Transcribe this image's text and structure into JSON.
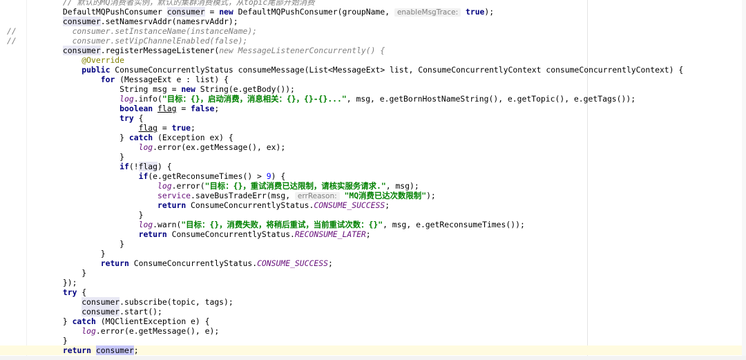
{
  "editor": {
    "lines": [
      [
        {
          "t": "        "
        },
        {
          "t": "// 默认的MQ消费者实例，默认的集群消费模式，从topic尾部开始消费",
          "c": "cm"
        }
      ],
      [
        {
          "t": "        DefaultMQPushConsumer "
        },
        {
          "t": "consumer",
          "c": "var"
        },
        {
          "t": " = "
        },
        {
          "t": "new",
          "c": "kw"
        },
        {
          "t": " DefaultMQPushConsumer(groupName, "
        },
        {
          "t": "enableMsgTrace:",
          "c": "hint"
        },
        {
          "t": " "
        },
        {
          "t": "true",
          "c": "kw"
        },
        {
          "t": ");"
        }
      ],
      [
        {
          "t": "        "
        },
        {
          "t": "consumer",
          "c": "var"
        },
        {
          "t": ".setNamesrvAddr(namesrvAddr);"
        }
      ],
      [
        {
          "t": "          "
        },
        {
          "t": "consumer",
          "c": "cm"
        },
        {
          "t": ".setInstanceName(instanceName);",
          "c": "cm"
        }
      ],
      [
        {
          "t": "          "
        },
        {
          "t": "consumer",
          "c": "cm"
        },
        {
          "t": ".setVipChannelEnabled(false);",
          "c": "cm"
        }
      ],
      [
        {
          "t": "        "
        },
        {
          "t": "consumer",
          "c": "var"
        },
        {
          "t": ".registerMessageListener("
        },
        {
          "t": "new MessageListenerConcurrently() {",
          "c": "cm"
        }
      ],
      [
        {
          "t": "            "
        },
        {
          "t": "@Override",
          "c": "ann"
        }
      ],
      [
        {
          "t": "            "
        },
        {
          "t": "public",
          "c": "kw"
        },
        {
          "t": " ConsumeConcurrentlyStatus consumeMessage(List<MessageExt> list, ConsumeConcurrentlyContext consumeConcurrentlyContext) {"
        }
      ],
      [
        {
          "t": "                "
        },
        {
          "t": "for",
          "c": "kw"
        },
        {
          "t": " (MessageExt e : list) {"
        }
      ],
      [
        {
          "t": "                    String msg = "
        },
        {
          "t": "new",
          "c": "kw"
        },
        {
          "t": " String(e.getBody());"
        }
      ],
      [
        {
          "t": "                    "
        },
        {
          "t": "log",
          "c": "logv"
        },
        {
          "t": ".info("
        },
        {
          "t": "\"目标：{}，启动消费，消息相关：{}，{}-{}...\"",
          "c": "str"
        },
        {
          "t": ", msg, e.getBornHostNameString(), e.getTopic(), e.getTags());"
        }
      ],
      [
        {
          "t": "                    "
        },
        {
          "t": "boolean",
          "c": "kw"
        },
        {
          "t": " "
        },
        {
          "t": "flag",
          "c": "uline"
        },
        {
          "t": " = "
        },
        {
          "t": "false",
          "c": "kw"
        },
        {
          "t": ";"
        }
      ],
      [
        {
          "t": "                    "
        },
        {
          "t": "try",
          "c": "kw"
        },
        {
          "t": " {"
        }
      ],
      [
        {
          "t": "                        "
        },
        {
          "t": "flag",
          "c": "uline"
        },
        {
          "t": " = "
        },
        {
          "t": "true",
          "c": "kw"
        },
        {
          "t": ";"
        }
      ],
      [
        {
          "t": "                    } "
        },
        {
          "t": "catch",
          "c": "kw"
        },
        {
          "t": " (Exception ex) {"
        }
      ],
      [
        {
          "t": "                        "
        },
        {
          "t": "log",
          "c": "logv"
        },
        {
          "t": ".error(ex.getMessage(), ex);"
        }
      ],
      [
        {
          "t": "                    }"
        }
      ],
      [
        {
          "t": "                    "
        },
        {
          "t": "if",
          "c": "kw"
        },
        {
          "t": "(!"
        },
        {
          "t": "flag",
          "c": "var"
        },
        {
          "t": ") {"
        }
      ],
      [
        {
          "t": "                        "
        },
        {
          "t": "if",
          "c": "kw"
        },
        {
          "t": "(e.getReconsumeTimes() > "
        },
        {
          "t": "9",
          "c": "num"
        },
        {
          "t": ") {"
        }
      ],
      [
        {
          "t": "                            "
        },
        {
          "t": "log",
          "c": "logv"
        },
        {
          "t": ".error("
        },
        {
          "t": "\"目标：{}，重试消费已达限制，请核实服务请求.\"",
          "c": "str"
        },
        {
          "t": ", msg);"
        }
      ],
      [
        {
          "t": "                            "
        },
        {
          "t": "service",
          "c": "fld"
        },
        {
          "t": ".saveBusTradeErr(msg, "
        },
        {
          "t": "errReason:",
          "c": "hint"
        },
        {
          "t": " "
        },
        {
          "t": "\"MQ消费已达次数限制\"",
          "c": "str"
        },
        {
          "t": ");"
        }
      ],
      [
        {
          "t": "                            "
        },
        {
          "t": "return",
          "c": "kw"
        },
        {
          "t": " ConsumeConcurrentlyStatus."
        },
        {
          "t": "CONSUME_SUCCESS",
          "c": "stat"
        },
        {
          "t": ";"
        }
      ],
      [
        {
          "t": "                        }"
        }
      ],
      [
        {
          "t": "                        "
        },
        {
          "t": "log",
          "c": "logv"
        },
        {
          "t": ".warn("
        },
        {
          "t": "\"目标：{}，消费失败，将稍后重试，当前重试次数：{}\"",
          "c": "str"
        },
        {
          "t": ", msg, e.getReconsumeTimes());"
        }
      ],
      [
        {
          "t": "                        "
        },
        {
          "t": "return",
          "c": "kw"
        },
        {
          "t": " ConsumeConcurrentlyStatus."
        },
        {
          "t": "RECONSUME_LATER",
          "c": "stat"
        },
        {
          "t": ";"
        }
      ],
      [
        {
          "t": "                    }"
        }
      ],
      [
        {
          "t": "                }"
        }
      ],
      [
        {
          "t": "                "
        },
        {
          "t": "return",
          "c": "kw"
        },
        {
          "t": " ConsumeConcurrentlyStatus."
        },
        {
          "t": "CONSUME_SUCCESS",
          "c": "stat"
        },
        {
          "t": ";"
        }
      ],
      [
        {
          "t": "            }"
        }
      ],
      [
        {
          "t": "        });"
        }
      ],
      [
        {
          "t": "        "
        },
        {
          "t": "try",
          "c": "kw"
        },
        {
          "t": " {"
        }
      ],
      [
        {
          "t": "            "
        },
        {
          "t": "consumer",
          "c": "var"
        },
        {
          "t": ".subscribe(topic, tags);"
        }
      ],
      [
        {
          "t": "            "
        },
        {
          "t": "consumer",
          "c": "var"
        },
        {
          "t": ".start();"
        }
      ],
      [
        {
          "t": "        } "
        },
        {
          "t": "catch",
          "c": "kw"
        },
        {
          "t": " (MQClientException e) {"
        }
      ],
      [
        {
          "t": "            "
        },
        {
          "t": "log",
          "c": "logv"
        },
        {
          "t": ".error(e.getMessage(), e);"
        }
      ],
      [
        {
          "t": "        }"
        }
      ],
      [
        {
          "t": "        "
        },
        {
          "t": "return",
          "c": "kw"
        },
        {
          "t": " "
        },
        {
          "t": "consumer",
          "c": "sel"
        },
        {
          "t": ";"
        }
      ]
    ],
    "comment_markers": [
      "//",
      "//"
    ]
  }
}
